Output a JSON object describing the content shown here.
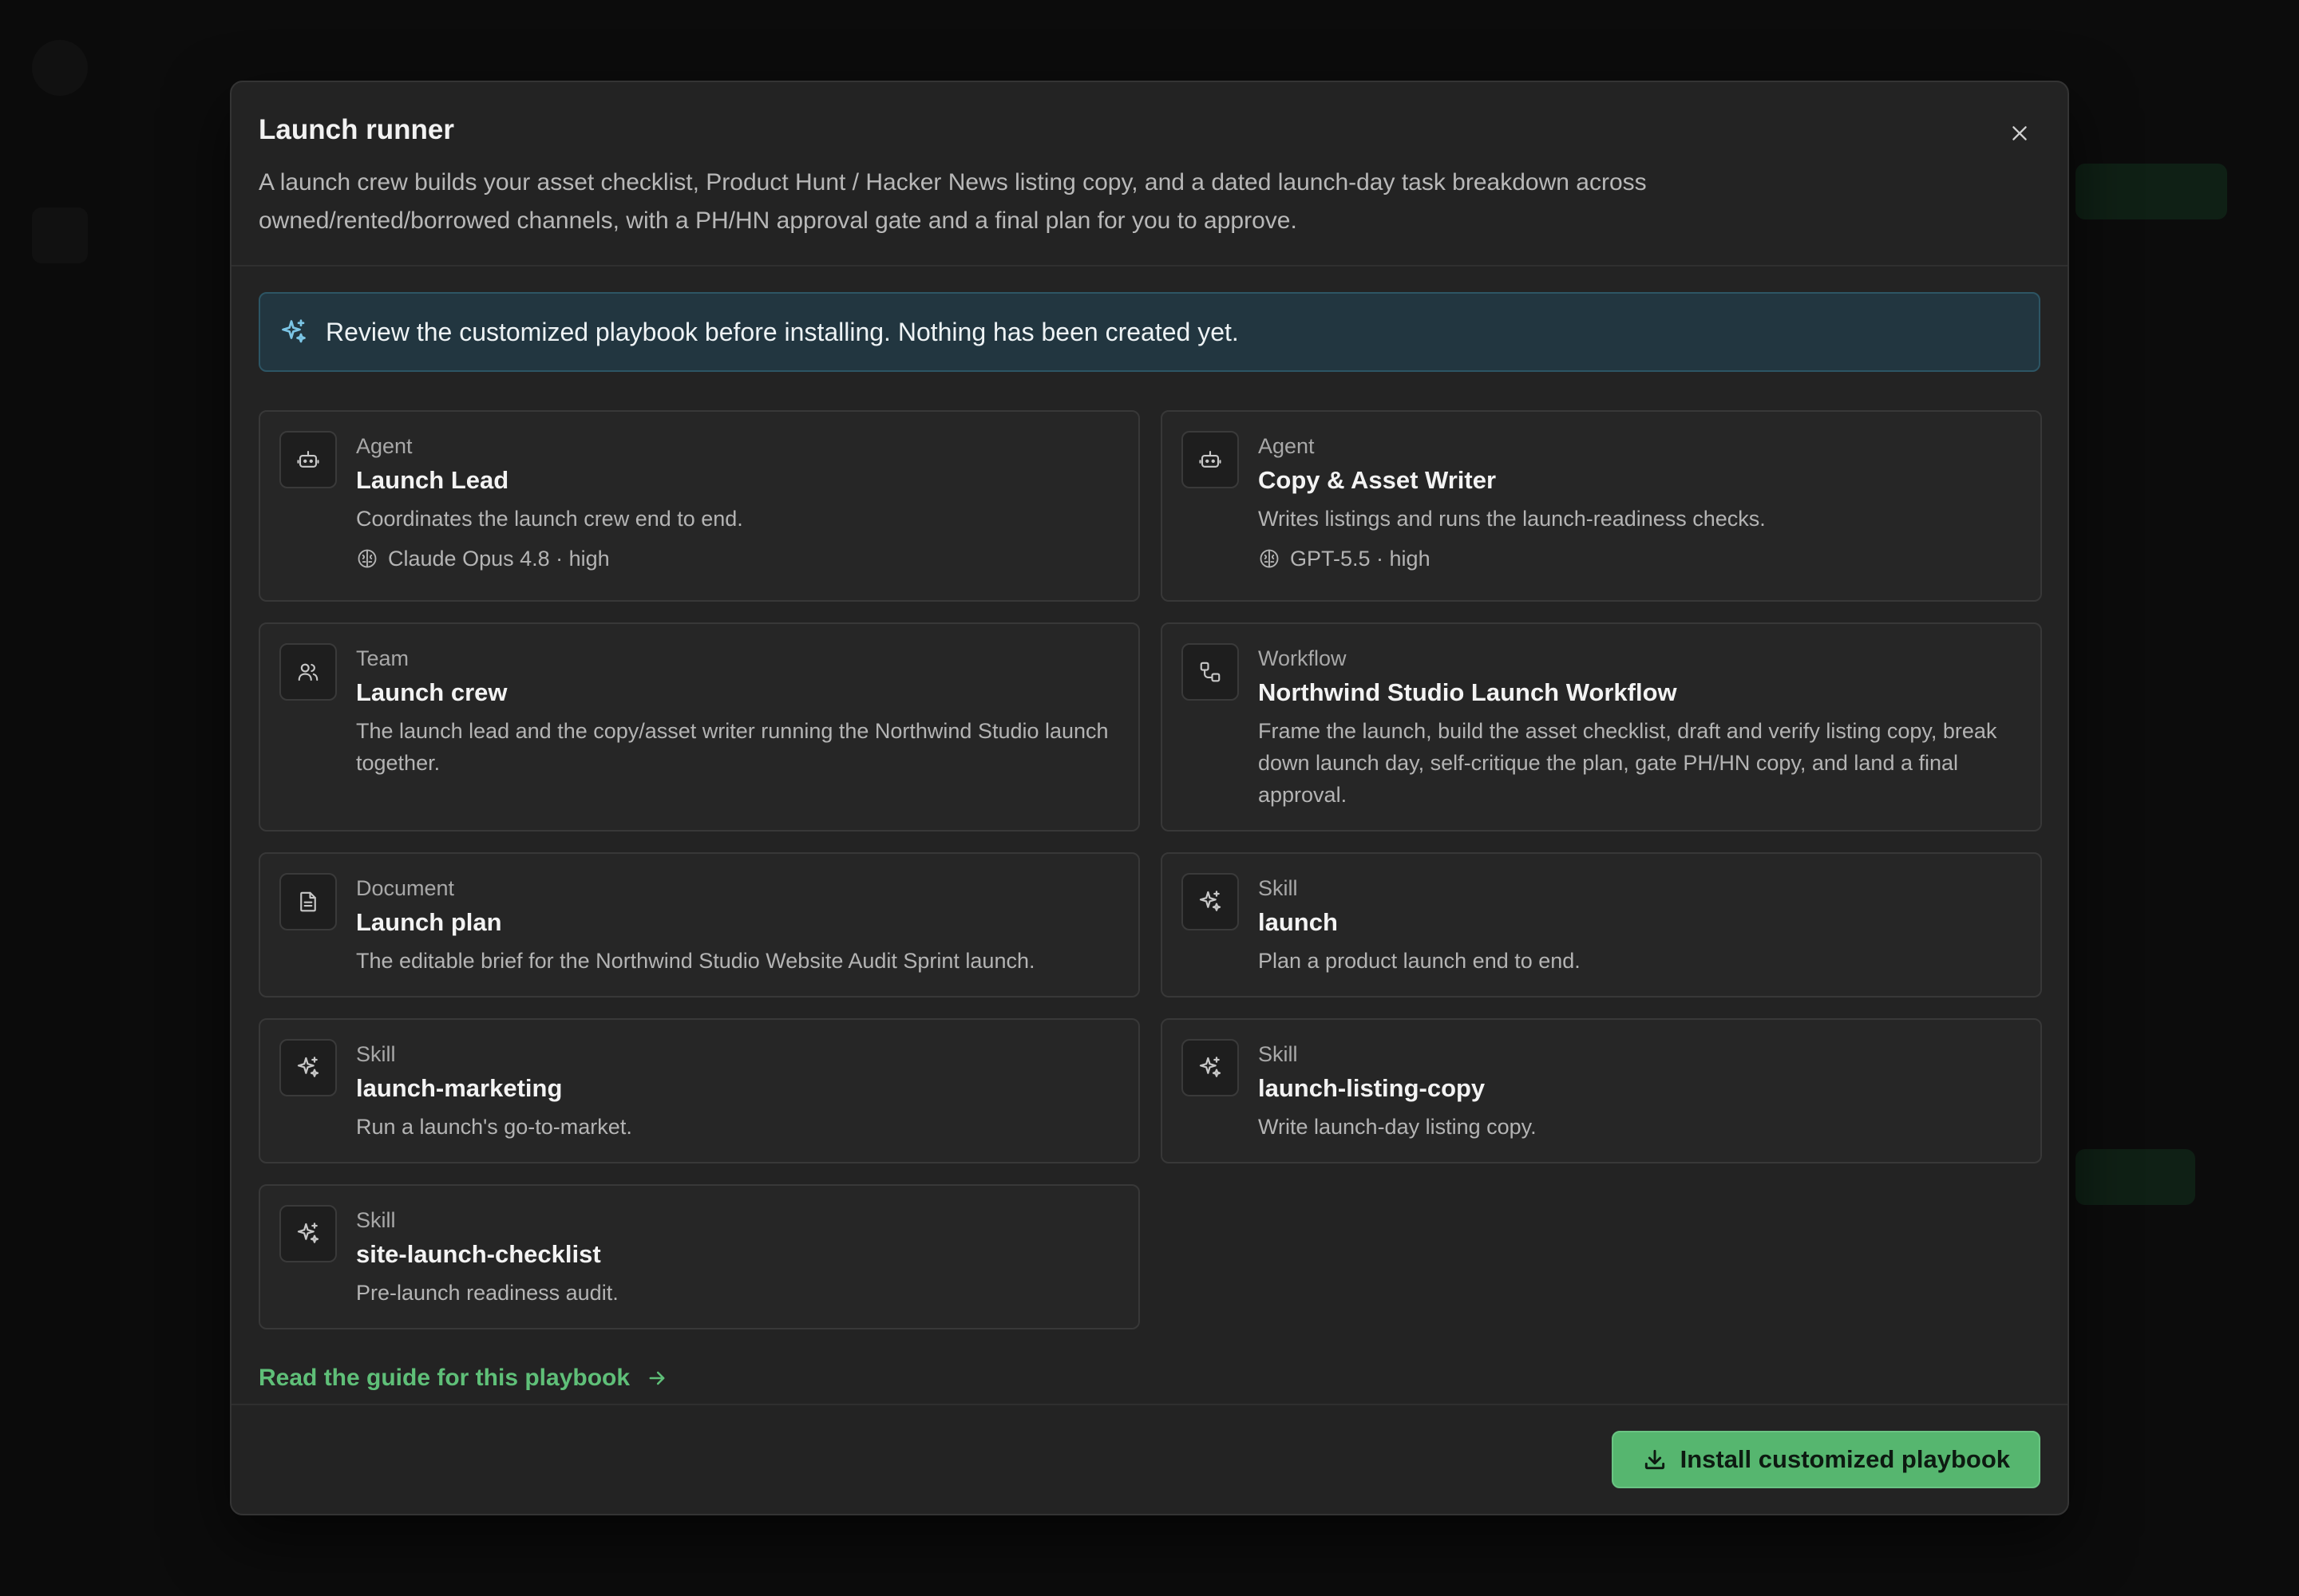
{
  "modal": {
    "title": "Launch runner",
    "description": "A launch crew builds your asset checklist, Product Hunt / Hacker News listing copy, and a dated launch-day task breakdown across owned/rented/borrowed channels, with a PH/HN approval gate and a final plan for you to approve.",
    "close_icon": "close-icon"
  },
  "notice": {
    "icon": "sparkles-icon",
    "text": "Review the customized playbook before installing. Nothing has been created yet."
  },
  "cards": [
    {
      "kind": "Agent",
      "name": "Launch Lead",
      "desc": "Coordinates the launch crew end to end.",
      "model": "Claude Opus 4.8 · high",
      "icon": "robot-icon"
    },
    {
      "kind": "Agent",
      "name": "Copy & Asset Writer",
      "desc": "Writes listings and runs the launch-readiness checks.",
      "model": "GPT-5.5 · high",
      "icon": "robot-icon"
    },
    {
      "kind": "Team",
      "name": "Launch crew",
      "desc": "The launch lead and the copy/asset writer running the Northwind Studio launch together.",
      "icon": "users-icon"
    },
    {
      "kind": "Workflow",
      "name": "Northwind Studio Launch Workflow",
      "desc": "Frame the launch, build the asset checklist, draft and verify listing copy, break down launch day, self-critique the plan, gate PH/HN copy, and land a final approval.",
      "icon": "workflow-icon"
    },
    {
      "kind": "Document",
      "name": "Launch plan",
      "desc": "The editable brief for the Northwind Studio Website Audit Sprint launch.",
      "icon": "document-icon"
    },
    {
      "kind": "Skill",
      "name": "launch",
      "desc": "Plan a product launch end to end.",
      "icon": "sparkles-icon"
    },
    {
      "kind": "Skill",
      "name": "launch-marketing",
      "desc": "Run a launch's go-to-market.",
      "icon": "sparkles-icon"
    },
    {
      "kind": "Skill",
      "name": "launch-listing-copy",
      "desc": "Write launch-day listing copy.",
      "icon": "sparkles-icon"
    },
    {
      "kind": "Skill",
      "name": "site-launch-checklist",
      "desc": "Pre-launch readiness audit.",
      "icon": "sparkles-icon"
    }
  ],
  "guide_link": {
    "label": "Read the guide for this playbook",
    "icon": "arrow-right-icon"
  },
  "footer": {
    "install_label": "Install customized playbook",
    "install_icon": "download-icon"
  },
  "colors": {
    "accent": "#56b66f",
    "link": "#5fbf78",
    "notice_bg": "#223640",
    "notice_border": "#2d5564",
    "modal_bg": "#232323"
  }
}
